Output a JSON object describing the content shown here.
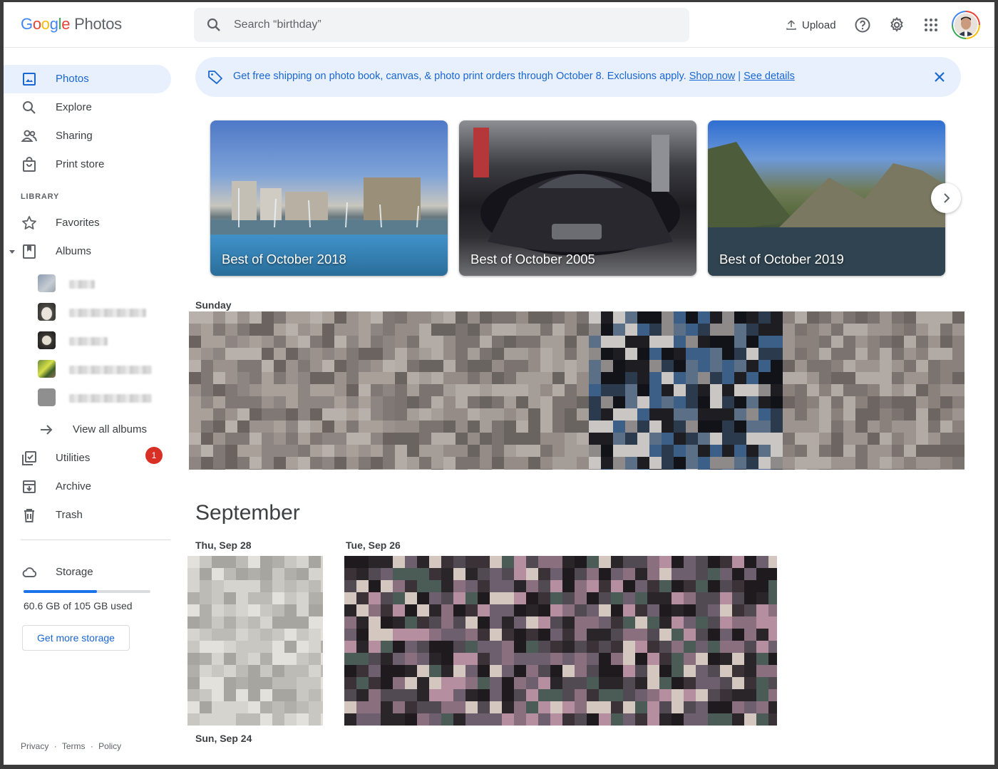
{
  "header": {
    "logo_letters": [
      {
        "ch": "G",
        "color": "#4285f4"
      },
      {
        "ch": "o",
        "color": "#ea4335"
      },
      {
        "ch": "o",
        "color": "#fbbc05"
      },
      {
        "ch": "g",
        "color": "#4285f4"
      },
      {
        "ch": "l",
        "color": "#34a853"
      },
      {
        "ch": "e",
        "color": "#ea4335"
      }
    ],
    "product": "Photos",
    "search_placeholder": "Search “birthday”",
    "upload_label": "Upload",
    "icons": [
      "help-icon",
      "settings-gear-icon",
      "apps-grid-icon"
    ]
  },
  "sidebar": {
    "items": [
      {
        "label": "Photos",
        "icon": "photo-icon",
        "active": true
      },
      {
        "label": "Explore",
        "icon": "search-icon"
      },
      {
        "label": "Sharing",
        "icon": "people-icon"
      },
      {
        "label": "Print store",
        "icon": "shopping-bag-icon"
      }
    ],
    "library_heading": "LIBRARY",
    "library_items": [
      {
        "label": "Favorites",
        "icon": "star-icon"
      },
      {
        "label": "Albums",
        "icon": "album-icon"
      }
    ],
    "view_all_albums": "View all albums",
    "utilities": {
      "label": "Utilities",
      "badge": "1"
    },
    "archive": "Archive",
    "trash": "Trash",
    "storage": {
      "label": "Storage",
      "used_text": "60.6 GB of 105 GB used",
      "fraction": 0.577,
      "button": "Get more storage"
    },
    "footer": [
      "Privacy",
      "·",
      "Terms",
      "·",
      "Policy"
    ]
  },
  "banner": {
    "text": "Get free shipping on photo book, canvas, & photo print orders through October 8. Exclusions apply.",
    "shop_now": "Shop now",
    "separator": "|",
    "see_details": "See details"
  },
  "memories": [
    {
      "title": "Best of October 2018"
    },
    {
      "title": "Best of October 2005"
    },
    {
      "title": "Best of October 2019"
    }
  ],
  "timeline": {
    "sunday": "Sunday",
    "month": "September",
    "thu": "Thu, Sep 28",
    "tue": "Tue, Sep 26",
    "sun24": "Sun, Sep 24"
  },
  "colors": {
    "accent": "#1967d2",
    "active_bg": "#e8f0fe",
    "badge": "#d93025"
  }
}
